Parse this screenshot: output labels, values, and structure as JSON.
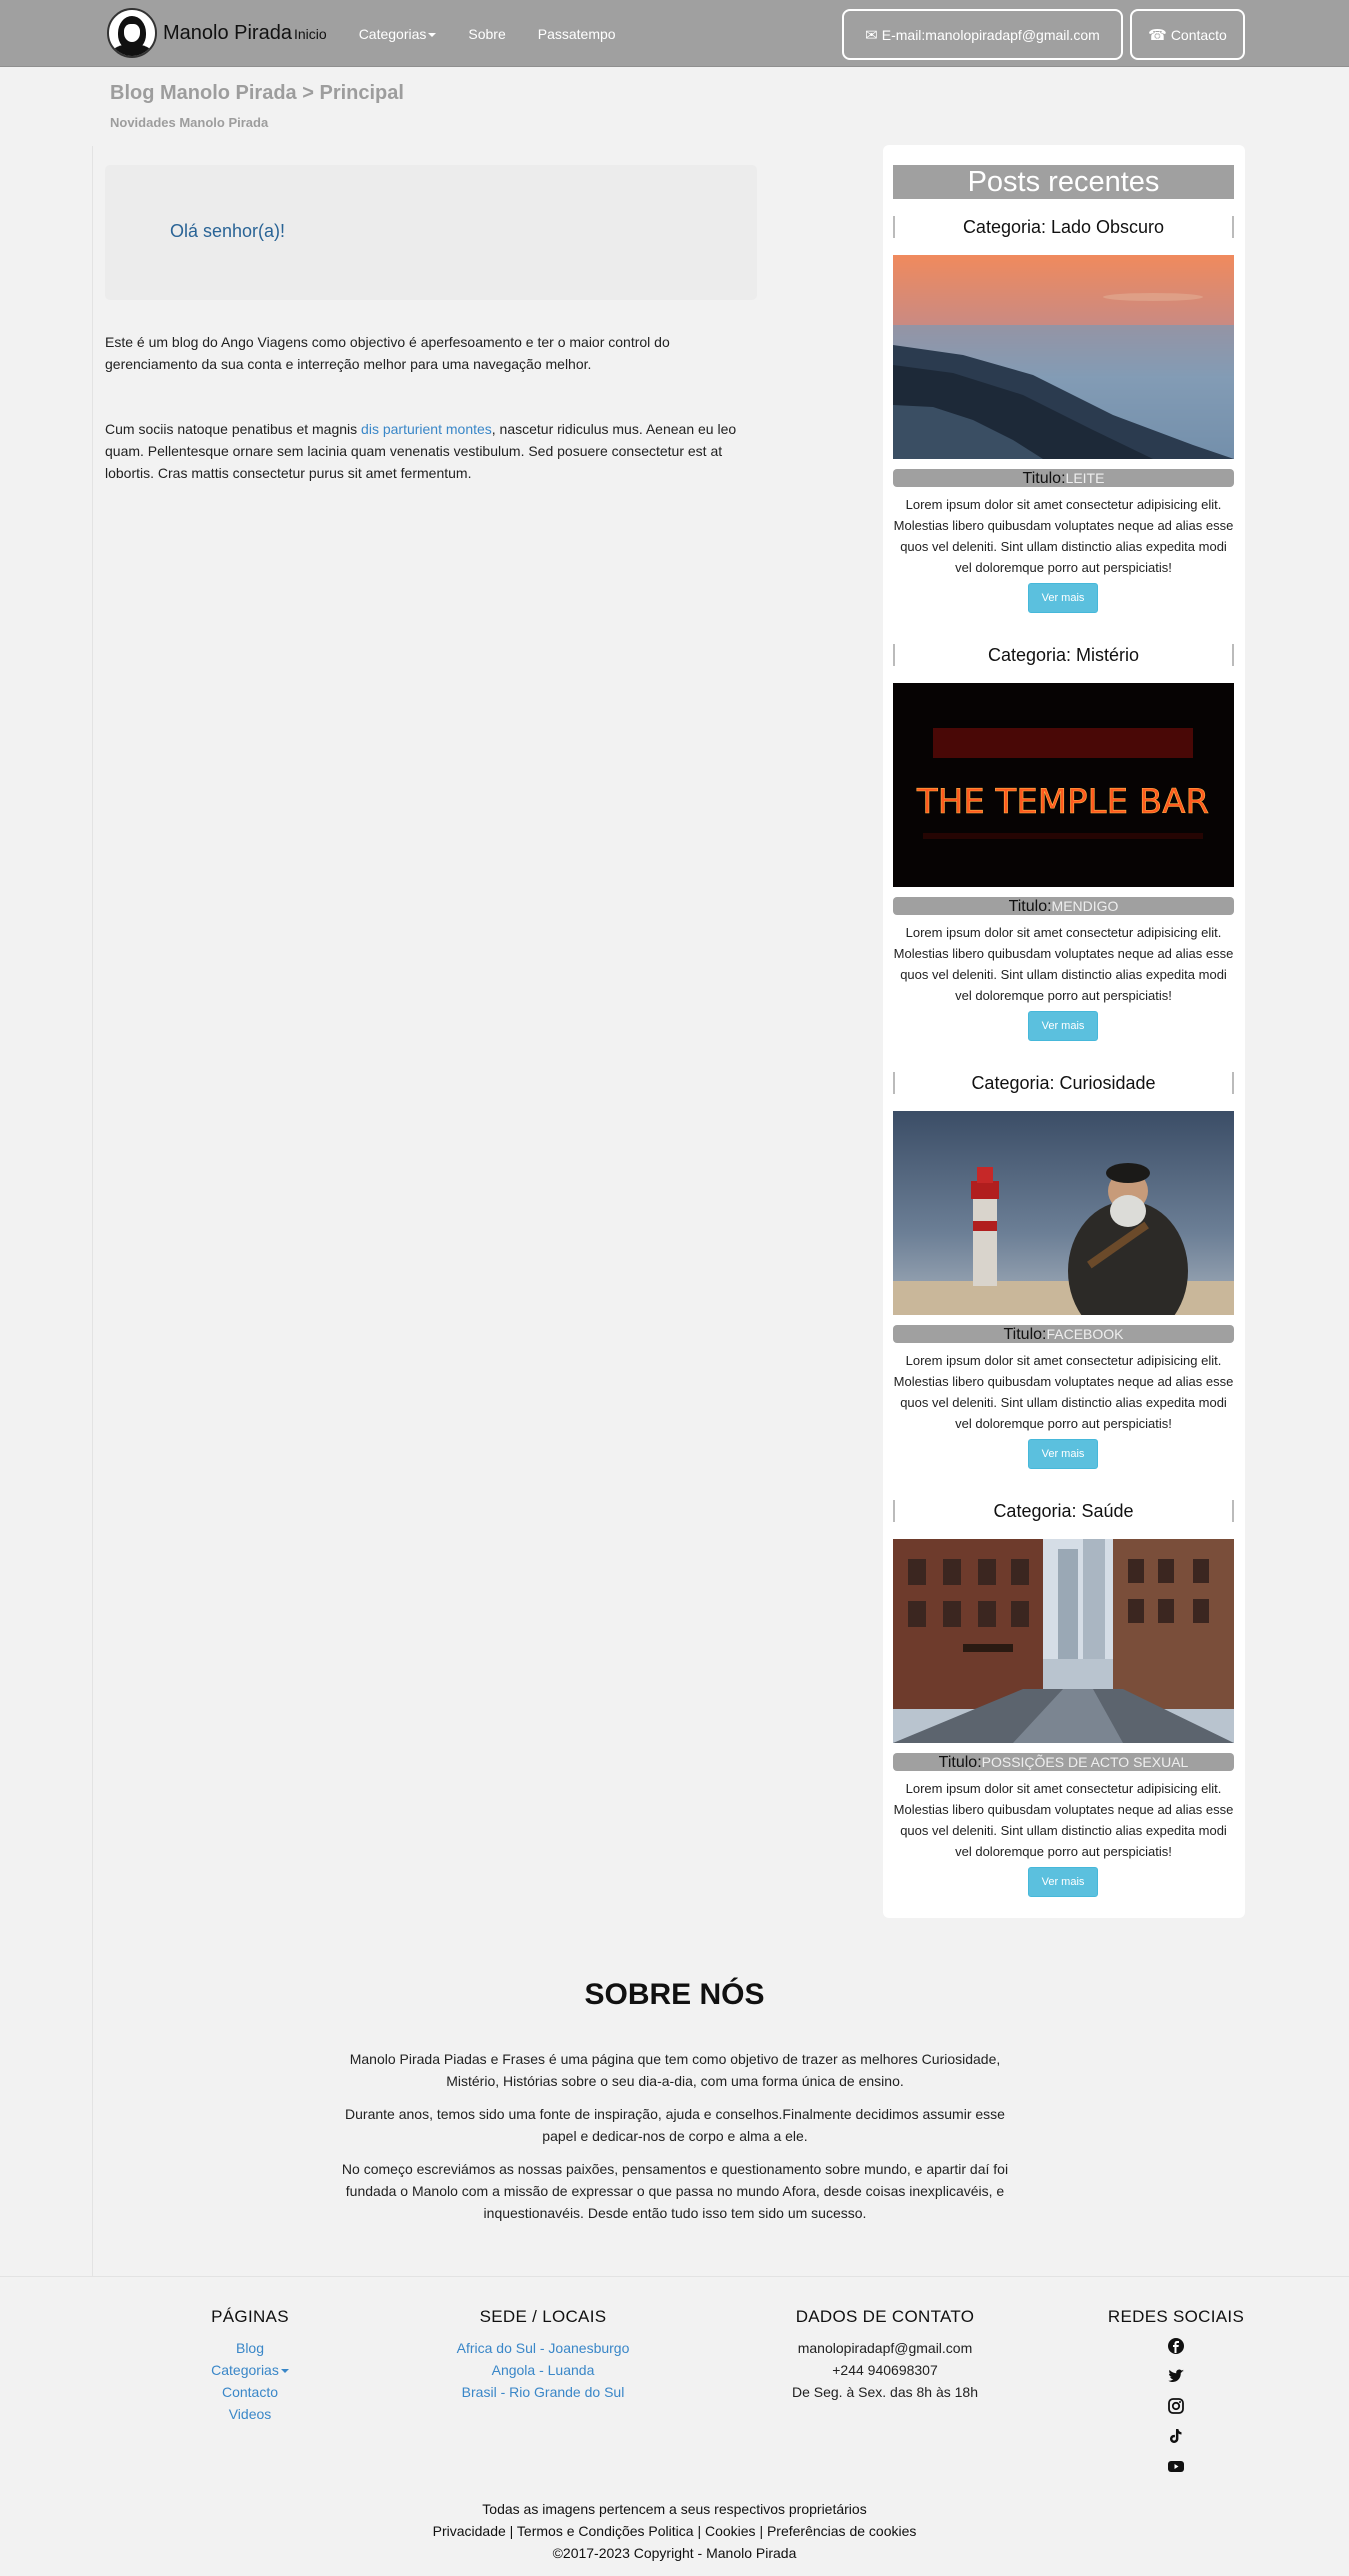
{
  "navbar": {
    "brand": "Manolo Pirada",
    "links": [
      "Inicio",
      "Categorias",
      "Sobre",
      "Passatempo"
    ],
    "email_button": "E-mail:manolopiradapf@gmail.com",
    "contact_button": "Contacto"
  },
  "breadcrumb": {
    "title": "Blog Manolo Pirada > Principal",
    "subtitle": "Novidades Manolo Pirada"
  },
  "main": {
    "greeting": "Olá senhor(a)!",
    "intro": "Este é um blog do Ango Viagens como objectivo é aperfesoamento e ter o maior control do gerenciamento da sua conta e interreção melhor para uma navegação melhor.",
    "para_start": "Cum sociis natoque penatibus et magnis ",
    "para_link": "dis parturient montes",
    "para_end": ", nascetur ridiculus mus. Aenean eu leo quam. Pellentesque ornare sem lacinia quam venenatis vestibulum. Sed posuere consectetur est at lobortis. Cras mattis consectetur purus sit amet fermentum."
  },
  "sidebar": {
    "heading": "Posts recentes",
    "posts": [
      {
        "category": "Categoria: Lado Obscuro",
        "title_label": "Titulo:",
        "title": "LEITE",
        "desc": "Lorem ipsum dolor sit amet consectetur adipisicing elit. Molestias libero quibusdam voluptates neque ad alias esse quos vel deleniti. Sint ullam distinctio alias expedita modi vel doloremque porro aut perspiciatis!",
        "button": "Ver mais"
      },
      {
        "category": "Categoria: Mistério",
        "title_label": "Titulo:",
        "title": "MENDIGO",
        "desc": "Lorem ipsum dolor sit amet consectetur adipisicing elit. Molestias libero quibusdam voluptates neque ad alias esse quos vel deleniti. Sint ullam distinctio alias expedita modi vel doloremque porro aut perspiciatis!",
        "button": "Ver mais",
        "sign": "THE TEMPLE BAR"
      },
      {
        "category": "Categoria: Curiosidade",
        "title_label": "Titulo:",
        "title": "FACEBOOK",
        "desc": "Lorem ipsum dolor sit amet consectetur adipisicing elit. Molestias libero quibusdam voluptates neque ad alias esse quos vel deleniti. Sint ullam distinctio alias expedita modi vel doloremque porro aut perspiciatis!",
        "button": "Ver mais"
      },
      {
        "category": "Categoria: Saúde",
        "title_label": "Titulo:",
        "title": "POSSIÇÕES DE ACTO SEXUAL",
        "desc": "Lorem ipsum dolor sit amet consectetur adipisicing elit. Molestias libero quibusdam voluptates neque ad alias esse quos vel deleniti. Sint ullam distinctio alias expedita modi vel doloremque porro aut perspiciatis!",
        "button": "Ver mais"
      }
    ]
  },
  "about": {
    "title": "SOBRE NÓS",
    "p1": "Manolo Pirada Piadas e Frases é uma página que tem como objetivo de trazer as melhores Curiosidade, Mistério, Histórias sobre o seu dia-a-dia, com uma forma única de ensino.",
    "p2": "Durante anos, temos sido uma fonte de inspiração, ajuda e conselhos.Finalmente decidimos assumir esse papel e dedicar-nos de corpo e alma a ele.",
    "p3": "No começo escreviámos as nossas paixões, pensamentos e questionamento sobre mundo, e apartir daí foi fundada o Manolo com a missão de expressar o que passa no mundo Afora, desde coisas inexplicavéis, e inquestionavéis. Desde então tudo isso tem sido um sucesso."
  },
  "footer": {
    "pages": {
      "heading": "PÁGINAS",
      "items": [
        "Blog",
        "Categorias",
        "Contacto",
        "Videos"
      ]
    },
    "locations": {
      "heading": "SEDE / LOCAIS",
      "items": [
        "Africa do Sul - Joanesburgo",
        "Angola - Luanda",
        "Brasil - Rio Grande do Sul"
      ]
    },
    "contact": {
      "heading": "DADOS DE CONTATO",
      "items": [
        "manolopiradapf@gmail.com",
        "+244 940698307",
        "De Seg. à Sex. das 8h às 18h"
      ]
    },
    "social": {
      "heading": "REDES SOCIAIS",
      "icons": [
        "facebook-icon",
        "twitter-icon",
        "instagram-icon",
        "tiktok-icon",
        "youtube-icon"
      ]
    },
    "rights": "Todas as imagens pertencem a seus respectivos proprietários",
    "legal_links": "Privacidade | Termos e Condições Politica | Cookies | Preferências de cookies",
    "copyright": "©2017-2023 Copyright - Manolo Pirada"
  },
  "colors": {
    "navbar": "#a0a0a0",
    "link": "#3a87c8",
    "info_button": "#5bc0de",
    "background": "#f2f2f2"
  }
}
